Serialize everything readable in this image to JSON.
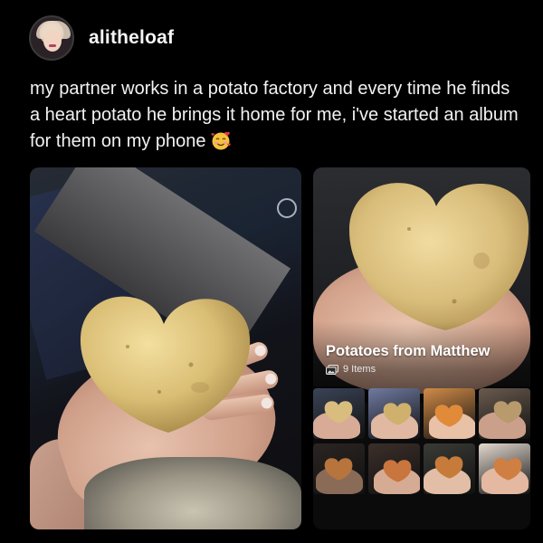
{
  "post": {
    "username": "alitheloaf",
    "caption": "my partner works in a potato factory and every time he finds a heart potato he brings it home for me, i've started an album for them on my phone"
  },
  "album": {
    "title": "Potatoes from Matthew",
    "count_label": "9 Items"
  },
  "icons": {
    "avatar": "profile-avatar",
    "emoji": "smiling-face-with-hearts",
    "album_count": "photos-stack-icon"
  },
  "thumbnails": [
    {
      "bg": "#3a4356",
      "hand": "#d7ab95",
      "potato": "#d8bd7e"
    },
    {
      "bg": "#6f7aa0",
      "hand": "#e1b9a3",
      "potato": "#cfb06c"
    },
    {
      "bg": "#d18b48",
      "hand": "#e8c1a7",
      "potato": "#e08a3a"
    },
    {
      "bg": "#6a5a4e",
      "hand": "#caa08a",
      "potato": "#b89a6c"
    },
    {
      "bg": "#2b2522",
      "hand": "#8a6b57",
      "potato": "#b8743d"
    },
    {
      "bg": "#3b2f2a",
      "hand": "#d6ab94",
      "potato": "#c9753e"
    },
    {
      "bg": "#3a3a36",
      "hand": "#e2bea6",
      "potato": "#c67b3a"
    },
    {
      "bg": "#e3d9cf",
      "hand": "#e4b8a1",
      "potato": "#cf7f42"
    }
  ]
}
